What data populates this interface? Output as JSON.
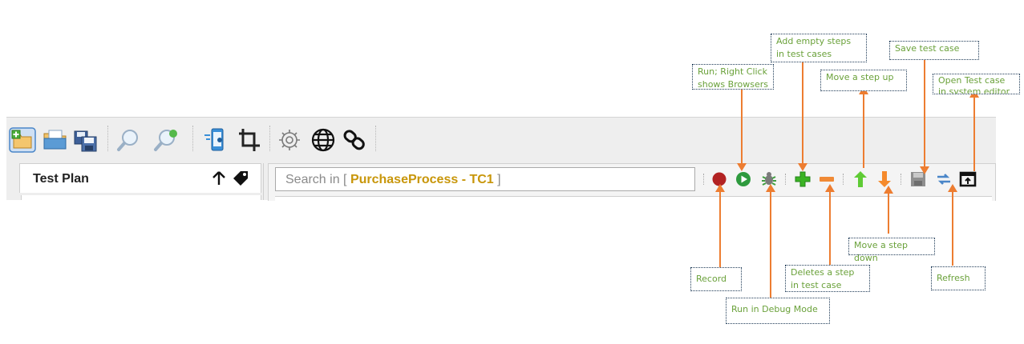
{
  "left_panel": {
    "title": "Test Plan",
    "actions": [
      "move-up-icon",
      "tag-icon"
    ]
  },
  "toolbar": {
    "icons": [
      "new-project-icon",
      "open-project-icon",
      "save-project-icon",
      "find-icon",
      "find-replace-icon",
      "mobile-spy-icon",
      "crop-icon",
      "settings-icon",
      "browser-icon",
      "link-icon"
    ]
  },
  "search": {
    "prefix": "Search in [ ",
    "context": "PurchaseProcess - TC1",
    "suffix": " ]"
  },
  "testcase_toolbar": {
    "buttons": [
      "record-icon",
      "run-icon",
      "debug-icon",
      "add-step-icon",
      "delete-step-icon",
      "move-up-icon",
      "move-down-icon",
      "save-icon",
      "refresh-icon",
      "open-editor-icon"
    ]
  },
  "annotations": {
    "run": "Run; Right Click shows Browsers",
    "add_steps": "Add empty steps in test cases",
    "save": "Save test case",
    "move_up": "Move a step up",
    "open_editor": "Open Test case in system editor",
    "move_down": "Move a step down",
    "record": "Record",
    "delete_step": "Deletes a step in test case",
    "refresh": "Refresh",
    "debug": "Run in Debug Mode"
  },
  "colors": {
    "annotation_text": "#6aa13a",
    "leader_line": "#ed7d31",
    "callout_border": "#1f3b57",
    "toolbar_bg": "#eeeeee",
    "search_context": "#c8960a",
    "record": "#b22222",
    "run": "#2e9a3e",
    "add": "#3bb324",
    "delete": "#f08a36",
    "up_arrow": "#5fcb35",
    "down_arrow": "#f58a2c"
  }
}
